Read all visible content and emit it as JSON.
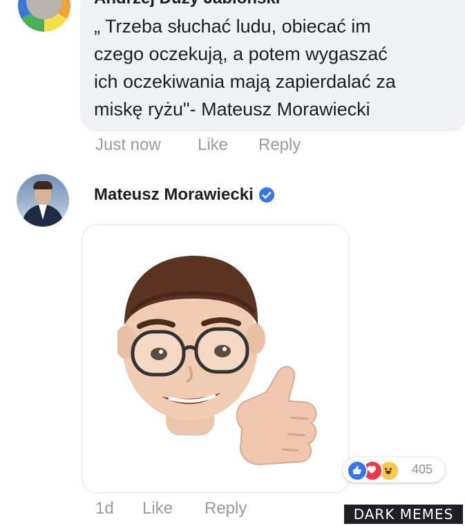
{
  "top_comment": {
    "author": "Andrzej Duży Jabłoński",
    "text": "„ Trzeba słuchać ludu, obiecać im\nczego oczekują, a potem wygaszać\nich oczekiwania mają zapierdalać za\nmiskę ryżu\"- Mateusz Morawiecki",
    "time": "Just now",
    "like_label": "Like",
    "reply_label": "Reply"
  },
  "reply_comment": {
    "author": "Mateusz Morawiecki",
    "verified_icon": "verified-badge-icon",
    "sticker": "thumbs-up-memoji",
    "reactions": {
      "icons": [
        "like-reaction-icon",
        "love-reaction-icon",
        "haha-reaction-icon"
      ],
      "count": "405"
    },
    "time": "1d",
    "like_label": "Like",
    "reply_label": "Reply"
  },
  "watermark": "DARK MEMES",
  "colors": {
    "link_blue": "#3578e5",
    "bubble_bg": "#eff1f5",
    "meta_gray": "#9a9ca2"
  }
}
